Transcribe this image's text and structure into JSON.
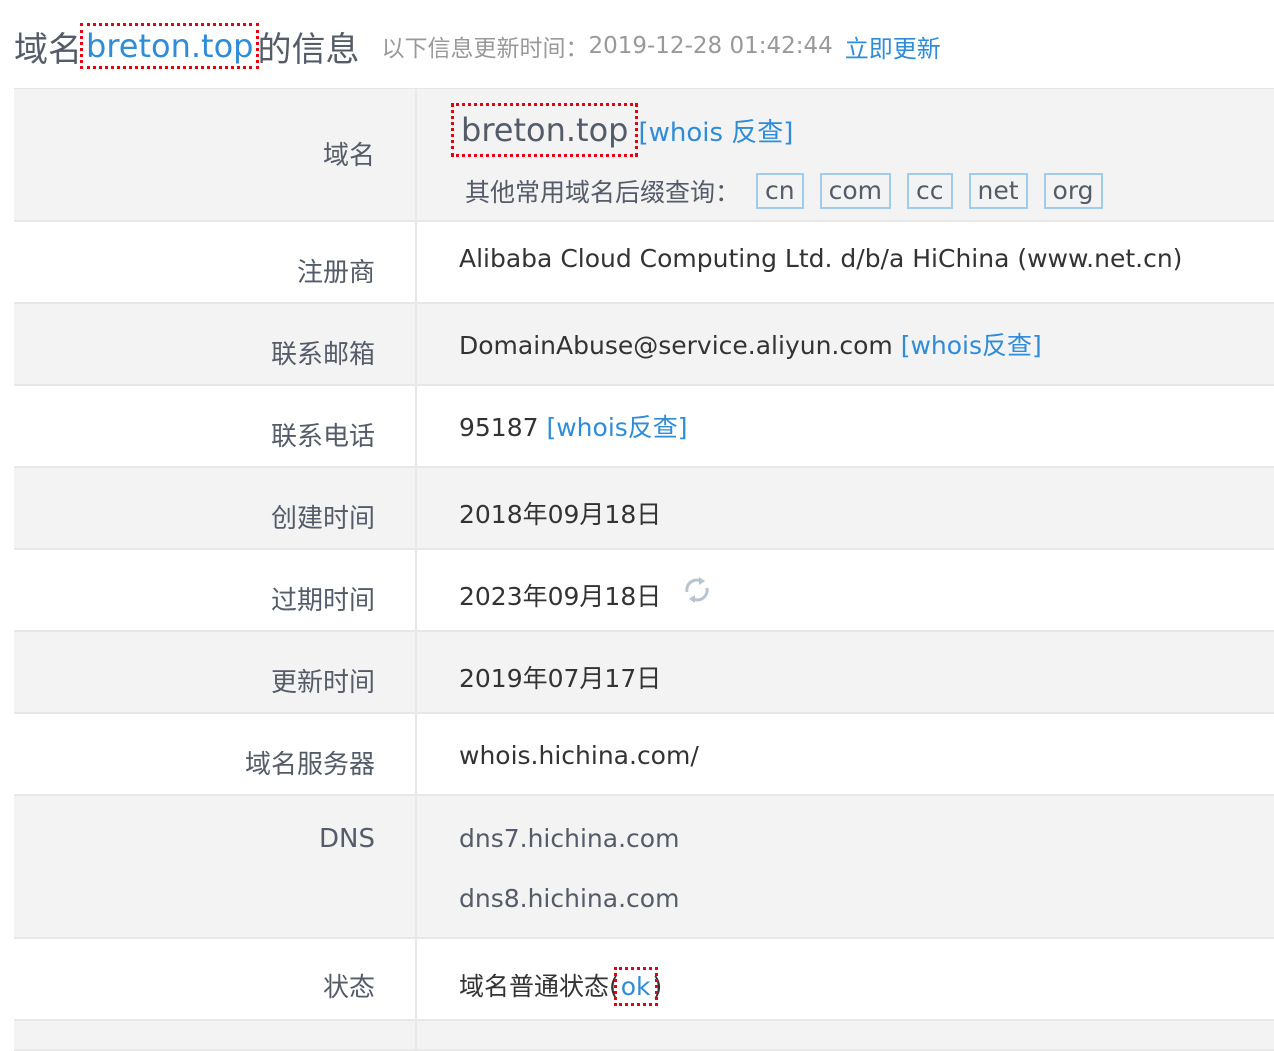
{
  "header": {
    "prefix": "域名",
    "domain": "breton.top",
    "suffix": "的信息",
    "update_label": "以下信息更新时间：",
    "update_time": "2019-12-28 01:42:44",
    "refresh_link": "立即更新"
  },
  "rows": {
    "domain": {
      "label": "域名",
      "value": "breton.top",
      "whois_link": "[whois 反查]",
      "suffix_label": "其他常用域名后缀查询：",
      "suffixes": [
        "cn",
        "com",
        "cc",
        "net",
        "org"
      ]
    },
    "registrar": {
      "label": "注册商",
      "value": "Alibaba Cloud Computing Ltd. d/b/a HiChina (www.net.cn)"
    },
    "email": {
      "label": "联系邮箱",
      "value": "DomainAbuse@service.aliyun.com",
      "whois_link": "[whois反查]"
    },
    "phone": {
      "label": "联系电话",
      "value": "95187",
      "whois_link": "[whois反查]"
    },
    "created": {
      "label": "创建时间",
      "value": "2018年09月18日"
    },
    "expires": {
      "label": "过期时间",
      "value": "2023年09月18日",
      "icon": "refresh-icon"
    },
    "updated": {
      "label": "更新时间",
      "value": "2019年07月17日"
    },
    "whois_server": {
      "label": "域名服务器",
      "value": "whois.hichina.com/"
    },
    "dns": {
      "label": "DNS",
      "values": [
        "dns7.hichina.com",
        "dns8.hichina.com"
      ]
    },
    "status": {
      "label": "状态",
      "value": "域名普通状态(",
      "link": "ok",
      "close": ")"
    }
  },
  "colors": {
    "link": "#2f8cd8",
    "label": "#555c69",
    "row_gray": "#f3f3f3",
    "highlight": "#e60012"
  }
}
